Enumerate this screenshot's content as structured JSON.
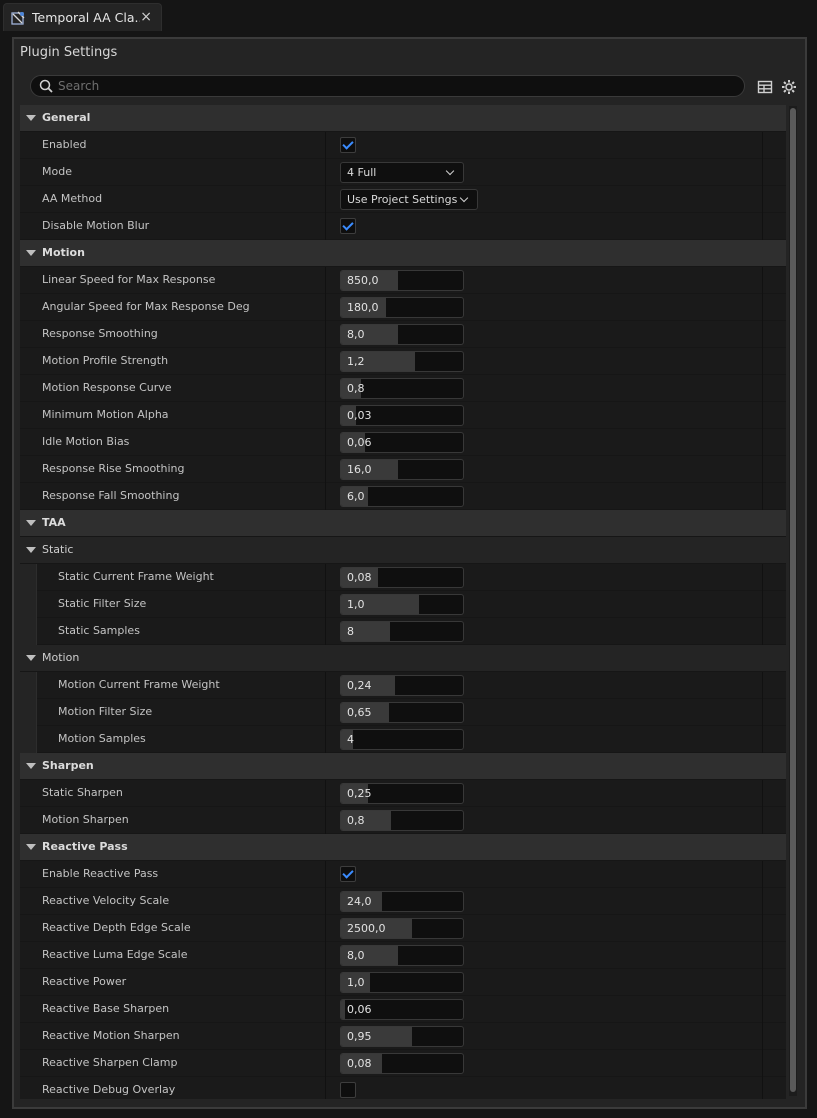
{
  "tab": {
    "title": "Temporal AA Cla...",
    "close_glyph": "×"
  },
  "panel": {
    "title": "Plugin Settings"
  },
  "search": {
    "placeholder": "Search",
    "value": ""
  },
  "colors": {
    "accent": "#3b8cff",
    "background": "#242424",
    "row": "#1a1a1a",
    "category": "#2f2f2f"
  },
  "rows": [
    {
      "kind": "cat",
      "label": "General"
    },
    {
      "kind": "prop",
      "label": "Enabled",
      "control": "checkbox",
      "checked": true
    },
    {
      "kind": "prop",
      "label": "Mode",
      "control": "combo",
      "value": "4 Full"
    },
    {
      "kind": "prop",
      "label": "AA Method",
      "control": "combo",
      "value": "Use Project Settings"
    },
    {
      "kind": "prop",
      "label": "Disable Motion Blur",
      "control": "checkbox",
      "checked": true
    },
    {
      "kind": "cat",
      "label": "Motion"
    },
    {
      "kind": "prop",
      "label": "Linear Speed for Max Response",
      "control": "number",
      "value": "850,0",
      "fill": 0.47
    },
    {
      "kind": "prop",
      "label": "Angular Speed for Max Response Deg",
      "control": "number",
      "value": "180,0",
      "fill": 0.37
    },
    {
      "kind": "prop",
      "label": "Response Smoothing",
      "control": "number",
      "value": "8,0",
      "fill": 0.47
    },
    {
      "kind": "prop",
      "label": "Motion Profile Strength",
      "control": "number",
      "value": "1,2",
      "fill": 0.61
    },
    {
      "kind": "prop",
      "label": "Motion Response Curve",
      "control": "number",
      "value": "0,8",
      "fill": 0.16
    },
    {
      "kind": "prop",
      "label": "Minimum Motion Alpha",
      "control": "number",
      "value": "0,03",
      "fill": 0.12
    },
    {
      "kind": "prop",
      "label": "Idle Motion Bias",
      "control": "number",
      "value": "0,06",
      "fill": 0.2
    },
    {
      "kind": "prop",
      "label": "Response Rise Smoothing",
      "control": "number",
      "value": "16,0",
      "fill": 0.47
    },
    {
      "kind": "prop",
      "label": "Response Fall Smoothing",
      "control": "number",
      "value": "6,0",
      "fill": 0.22
    },
    {
      "kind": "cat",
      "label": "TAA"
    },
    {
      "kind": "sub",
      "label": "Static"
    },
    {
      "kind": "nested",
      "label": "Static Current Frame Weight",
      "control": "number",
      "value": "0,08",
      "fill": 0.3
    },
    {
      "kind": "nested",
      "label": "Static Filter Size",
      "control": "number",
      "value": "1,0",
      "fill": 0.64
    },
    {
      "kind": "nested",
      "label": "Static Samples",
      "control": "number",
      "value": "8",
      "fill": 0.4
    },
    {
      "kind": "sub",
      "label": "Motion"
    },
    {
      "kind": "nested",
      "label": "Motion Current Frame Weight",
      "control": "number",
      "value": "0,24",
      "fill": 0.44
    },
    {
      "kind": "nested",
      "label": "Motion Filter Size",
      "control": "number",
      "value": "0,65",
      "fill": 0.39
    },
    {
      "kind": "nested",
      "label": "Motion Samples",
      "control": "number",
      "value": "4",
      "fill": 0.1
    },
    {
      "kind": "cat",
      "label": "Sharpen"
    },
    {
      "kind": "prop",
      "label": "Static Sharpen",
      "control": "number",
      "value": "0,25",
      "fill": 0.22
    },
    {
      "kind": "prop",
      "label": "Motion Sharpen",
      "control": "number",
      "value": "0,8",
      "fill": 0.41
    },
    {
      "kind": "cat",
      "label": "Reactive Pass"
    },
    {
      "kind": "prop",
      "label": "Enable Reactive Pass",
      "control": "checkbox",
      "checked": true
    },
    {
      "kind": "prop",
      "label": "Reactive Velocity Scale",
      "control": "number",
      "value": "24,0",
      "fill": 0.34
    },
    {
      "kind": "prop",
      "label": "Reactive Depth Edge Scale",
      "control": "number",
      "value": "2500,0",
      "fill": 0.58
    },
    {
      "kind": "prop",
      "label": "Reactive Luma Edge Scale",
      "control": "number",
      "value": "8,0",
      "fill": 0.47
    },
    {
      "kind": "prop",
      "label": "Reactive Power",
      "control": "number",
      "value": "1,0",
      "fill": 0.24
    },
    {
      "kind": "prop",
      "label": "Reactive Base Sharpen",
      "control": "number",
      "value": "0,06",
      "fill": 0.03
    },
    {
      "kind": "prop",
      "label": "Reactive Motion Sharpen",
      "control": "number",
      "value": "0,95",
      "fill": 0.58
    },
    {
      "kind": "prop",
      "label": "Reactive Sharpen Clamp",
      "control": "number",
      "value": "0,08",
      "fill": 0.34
    },
    {
      "kind": "prop",
      "label": "Reactive Debug Overlay",
      "control": "checkbox",
      "checked": false
    }
  ]
}
